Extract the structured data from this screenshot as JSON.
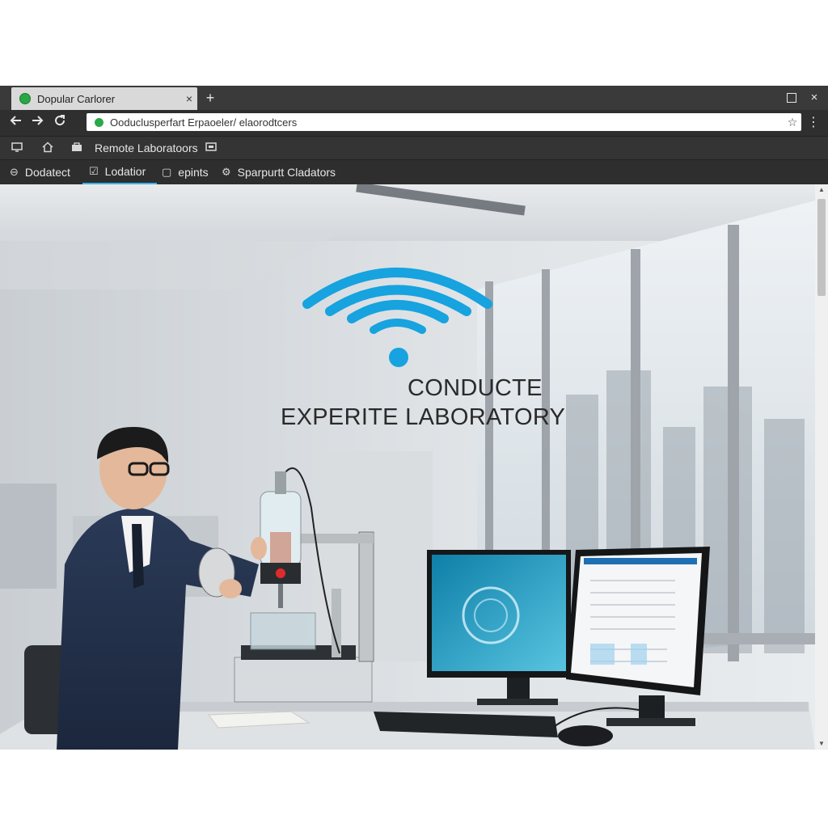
{
  "browser": {
    "tab_title": "Dopular Carlorer",
    "tab_close": "×",
    "new_tab": "+",
    "window_close": "×",
    "address": "Ooduclusperfart Erpaoeler/ elaorodtcers",
    "menu": "⋮",
    "star": "☆"
  },
  "bookmarks": {
    "label": "Remote Laboratoors"
  },
  "subnav": {
    "items": [
      {
        "label": "Dodatect"
      },
      {
        "label": "Lodatior"
      },
      {
        "label": "epints"
      },
      {
        "label": "Sparpurtt Cladators"
      }
    ],
    "active_index": 1
  },
  "hero": {
    "headline_line1": "CONDUCTE",
    "headline_line2": "EXPERITE LABORATORY"
  },
  "colors": {
    "accent": "#1aa5e0",
    "wifi": "#16a3df",
    "secure": "#2aa84a"
  }
}
